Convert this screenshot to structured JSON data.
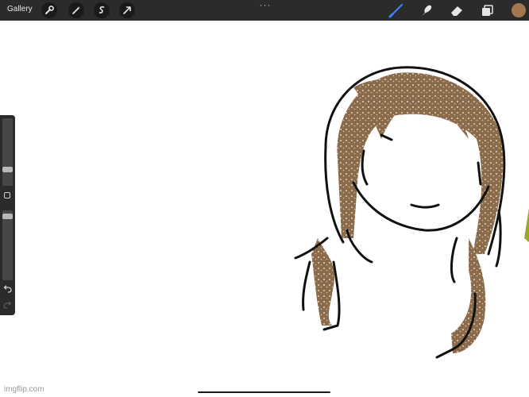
{
  "topbar": {
    "gallery_label": "Gallery",
    "left_tools": [
      "wrench-icon",
      "magic-wand-icon",
      "selection-icon",
      "transform-arrow-icon"
    ],
    "more_label": "···",
    "right_tools": [
      "brush-icon",
      "smudge-icon",
      "eraser-icon",
      "layers-icon"
    ],
    "current_color": "#a3774f",
    "accent_color": "#3b82f6"
  },
  "sidebar": {
    "brush_size_level": 0.45,
    "opacity_level": 0.17,
    "icons": [
      "modify-square-icon",
      "undo-icon",
      "redo-icon"
    ]
  },
  "drawing": {
    "outline_color": "#111111",
    "hair_color": "#8b6b4a",
    "accent_stroke_color": "#9aa52a"
  },
  "watermark": "imgflip.com"
}
